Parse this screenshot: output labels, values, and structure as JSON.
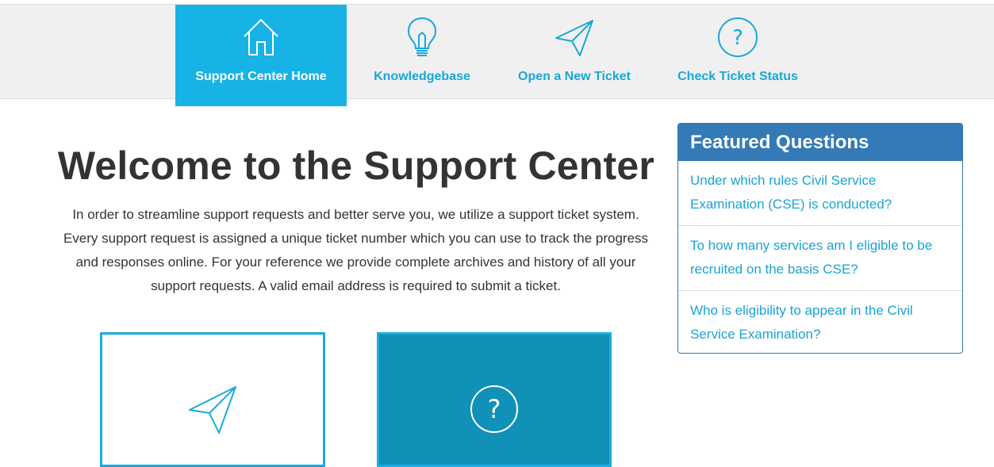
{
  "nav": {
    "items": [
      {
        "label": "Support Center Home",
        "icon": "home-icon",
        "active": true
      },
      {
        "label": "Knowledgebase",
        "icon": "lightbulb-icon",
        "active": false
      },
      {
        "label": "Open a New Ticket",
        "icon": "paper-plane-icon",
        "active": false
      },
      {
        "label": "Check Ticket Status",
        "icon": "question-circle-icon",
        "active": false
      }
    ]
  },
  "main": {
    "title": "Welcome to the Support Center",
    "intro": "In order to streamline support requests and better serve you, we utilize a support ticket system. Every support request is assigned a unique ticket number which you can use to track the progress and responses online. For your reference we provide complete archives and history of all your support requests. A valid email address is required to submit a ticket.",
    "cards": [
      {
        "icon": "paper-plane-icon"
      },
      {
        "icon": "question-circle-icon"
      }
    ]
  },
  "featured": {
    "title": "Featured Questions",
    "questions": [
      "Under which rules Civil Service Examination (CSE) is conducted?",
      "To how many services am I eligible to be recruited on the basis CSE?",
      "Who is eligibility to appear in the Civil Service Examination?"
    ]
  },
  "colors": {
    "accent": "#18b3e6",
    "link": "#1aa7d9",
    "panel_header": "#337ab7",
    "card_dark": "#1190b8"
  }
}
